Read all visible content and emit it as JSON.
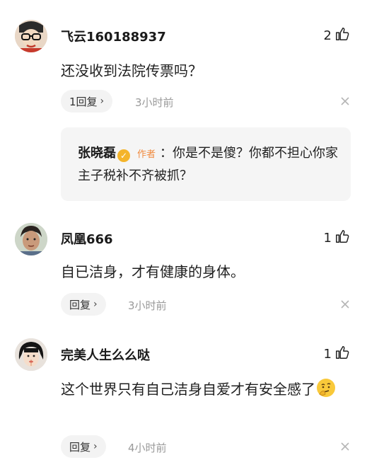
{
  "comments": [
    {
      "username": "飞云160188937",
      "likes": "2",
      "content": "还没收到法院传票吗？",
      "reply_label": "1回复",
      "time": "3小时前",
      "sub_reply": {
        "author": "张晓磊",
        "author_tag": "作者",
        "text": "：你是不是傻？你都不担心你家主子税补不齐被抓？"
      }
    },
    {
      "username": "凤凰666",
      "likes": "1",
      "content": "自已洁身，才有健康的身体。",
      "reply_label": "回复",
      "time": "3小时前"
    },
    {
      "username": "完美人生么么哒",
      "likes": "1",
      "content": "这个世界只有自己洁身自爱才有安全感了",
      "reply_label": "回复",
      "time": "4小时前"
    }
  ],
  "icons": {
    "like": "thumbs-up-icon",
    "close": "close-icon",
    "chevron": "chevron-right-icon",
    "verified": "verified-badge-icon",
    "emoji": "thinking-emoji-icon"
  },
  "colors": {
    "author_tag": "#f08a3e",
    "verified_badge": "#f4b42a",
    "reply_bg": "#f3f3f3",
    "time_text": "#9a9a9a"
  }
}
